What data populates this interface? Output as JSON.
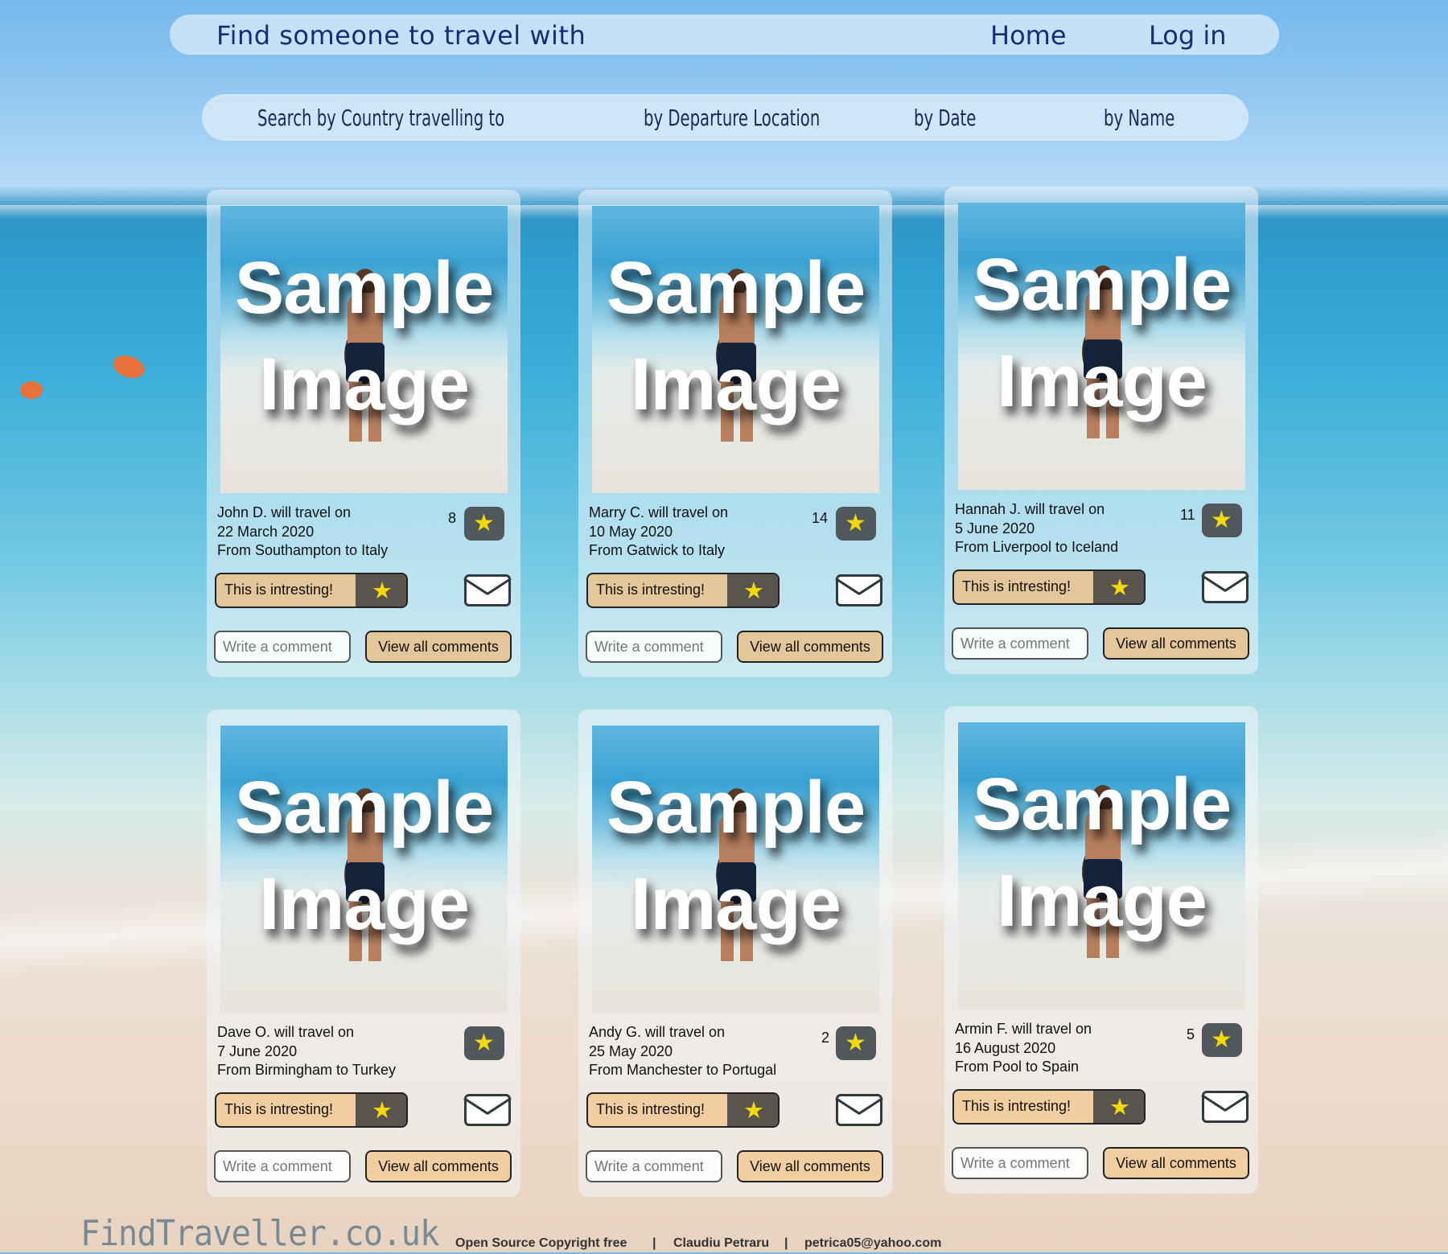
{
  "nav": {
    "title": "Find someone to travel with",
    "home": "Home",
    "login": "Log in"
  },
  "search": {
    "country": "Search by  Country  travelling to",
    "departure": "by Departure Location",
    "date": "by Date",
    "name": "by Name"
  },
  "photo": {
    "watermark_line1": "Sample",
    "watermark_line2": "Image"
  },
  "cards": [
    {
      "line1": "John D.  will travel  on",
      "line2": "22 March 2020",
      "line3": "From Southampton to Italy",
      "count": "8",
      "like_label": "This is intresting!",
      "comment_placeholder": "Write a comment",
      "view_label": "View all comments"
    },
    {
      "line1": "Marry C.  will travel  on",
      "line2": "10 May 2020",
      "line3": "From Gatwick to Italy",
      "count": "14",
      "like_label": "This is intresting!",
      "comment_placeholder": "Write a comment",
      "view_label": "View all comments"
    },
    {
      "line1": "Hannah J.  will travel  on",
      "line2": "5 June 2020",
      "line3": "From Liverpool to Iceland",
      "count": "11",
      "like_label": "This is intresting!",
      "comment_placeholder": "Write a comment",
      "view_label": "View all comments"
    },
    {
      "line1": "Dave O.  will travel  on",
      "line2": "7 June 2020",
      "line3": "From Birmingham to Turkey",
      "count": "",
      "like_label": "This is intresting!",
      "comment_placeholder": "Write a comment",
      "view_label": "View all comments"
    },
    {
      "line1": "Andy G.  will travel  on",
      "line2": "25 May 2020",
      "line3": "From Manchester to Portugal",
      "count": "2",
      "like_label": "This is intresting!",
      "comment_placeholder": "Write a comment",
      "view_label": "View all comments"
    },
    {
      "line1": "Armin F.  will travel  on",
      "line2": "16 August 2020",
      "line3": "From Pool to Spain",
      "count": "5",
      "like_label": "This is intresting!",
      "comment_placeholder": "Write a comment",
      "view_label": "View all comments"
    }
  ],
  "icons": {
    "star": "star-icon",
    "mail": "mail-icon"
  },
  "colors": {
    "nav_text": "#1a2a78",
    "star": "#f4d90a",
    "button": "#e3c79a"
  },
  "footer": {
    "logo": "FindTraveller.co.uk",
    "copyright": "Open Source  Copyright free",
    "sep1": "|",
    "author": "Claudiu Petraru",
    "sep2": "|",
    "email": "petrica05@yahoo.com"
  }
}
